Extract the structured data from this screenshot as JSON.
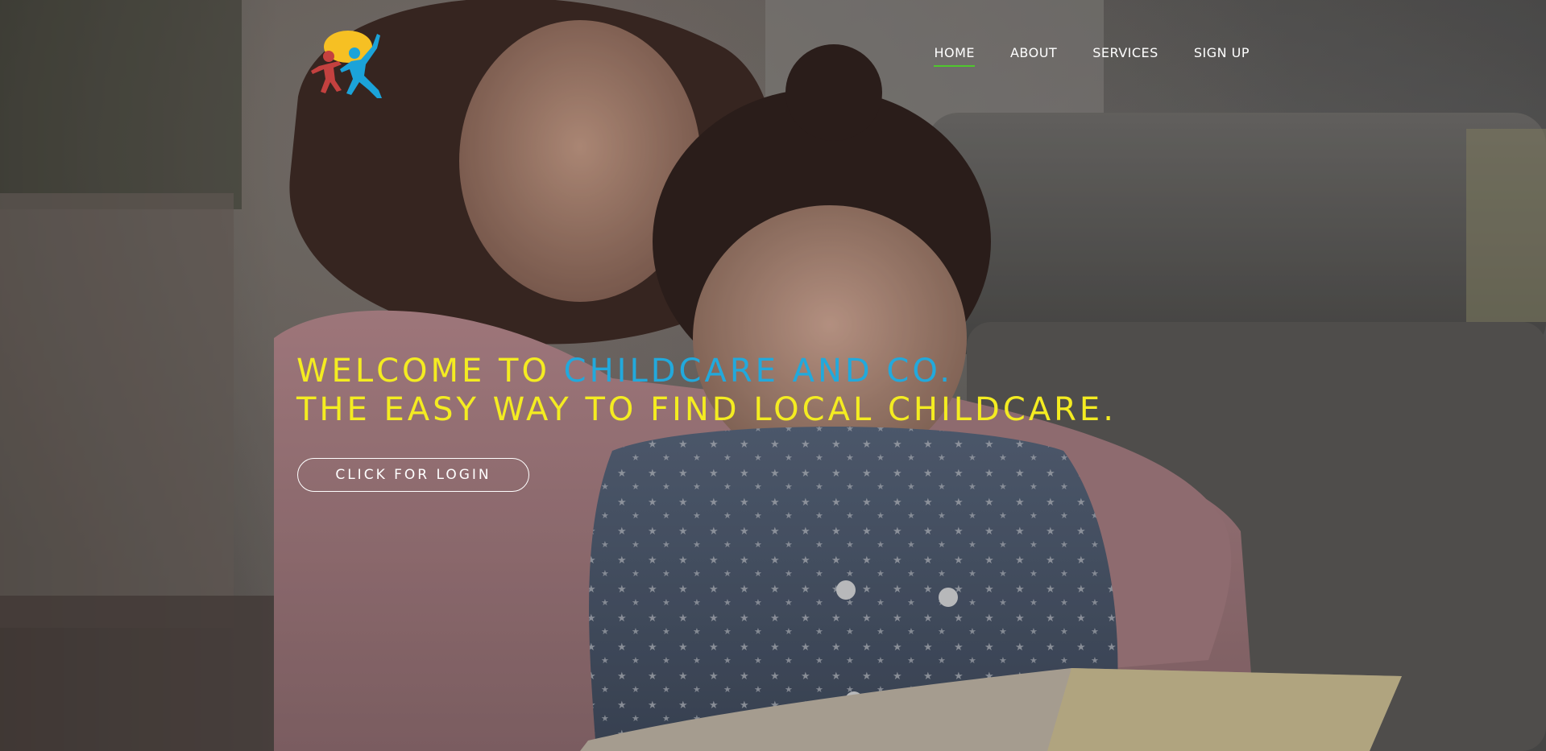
{
  "nav": {
    "items": [
      {
        "label": "HOME",
        "active": true
      },
      {
        "label": "ABOUT",
        "active": false
      },
      {
        "label": "SERVICES",
        "active": false
      },
      {
        "label": "SIGN UP",
        "active": false
      }
    ],
    "active_underline_color": "#4fc72d"
  },
  "hero": {
    "line1_prefix": "WELCOME TO ",
    "line1_brand": "CHILDCARE AND CO.",
    "line2": "THE EASY WAY TO FIND LOCAL CHILDCARE.",
    "login_button": "CLICK FOR LOGIN",
    "headline_color": "#f4ec21",
    "brand_color": "#22a9dc"
  },
  "logo": {
    "icon": "children-playing-logo-icon",
    "colors": {
      "sun": "#f6c023",
      "child_left": "#c4413f",
      "child_right": "#1ba3d9"
    }
  },
  "background": {
    "icon": "mother-reading-with-child-photo"
  }
}
